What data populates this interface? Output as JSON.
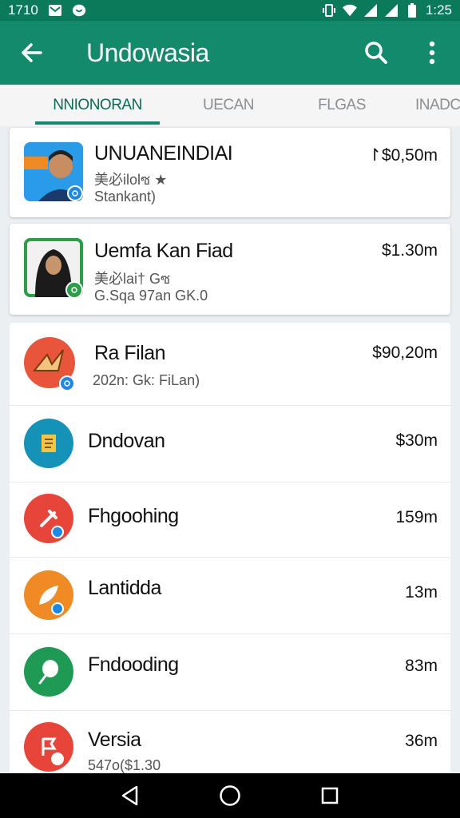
{
  "status_bar": {
    "time_left": "1710",
    "time_right": "1:25",
    "icons": [
      "mail-icon",
      "heart-icon",
      "vibrate-icon",
      "wifi-icon",
      "signal-icon",
      "signal-icon",
      "battery-icon"
    ]
  },
  "app_bar": {
    "title": "Undowasia",
    "back_icon": "arrow-left-icon",
    "search_icon": "search-icon",
    "menu_icon": "more-vert-icon"
  },
  "tabs": [
    {
      "label": "NNIONORAN",
      "active": true
    },
    {
      "label": "UECAN",
      "active": false
    },
    {
      "label": "FLGAS",
      "active": false
    },
    {
      "label": "INADC",
      "active": false
    }
  ],
  "items": [
    {
      "title": "UNUANEINDIAI",
      "sub1": "美必ilolซ ★",
      "sub2": "Stankant)",
      "amount": "↾$0,50m",
      "icon": "person-photo",
      "color": "#1e88e5"
    },
    {
      "title": "Uemfa Kan Fiad",
      "sub1": "美必lai† Gซ",
      "sub2": "G.Sqa 97an GK.0",
      "amount": "$1.30m",
      "icon": "person-photo",
      "color": "#2e9d4a"
    },
    {
      "title": "Ra Filan",
      "sub1": "202n: Gk: FiLan)",
      "amount": "$90,20m",
      "icon": "bird-icon",
      "color": "#e8553a"
    },
    {
      "title": "Dndovan",
      "amount": "$30m",
      "icon": "document-icon",
      "color": "#1592b8"
    },
    {
      "title": "Fhgoohing",
      "amount": "159m",
      "icon": "tool-icon",
      "color": "#e8453a"
    },
    {
      "title": "Lantidda",
      "amount": "13m",
      "icon": "leaf-icon",
      "color": "#f08a24"
    },
    {
      "title": "Fndooding",
      "amount": "83m",
      "icon": "balloon-icon",
      "color": "#1e9a55"
    },
    {
      "title": "Versia",
      "sub1": "547o($1.30",
      "amount": "36m",
      "icon": "flag-icon",
      "color": "#e8453a"
    }
  ],
  "nav": [
    "back-triangle-icon",
    "home-circle-icon",
    "recents-square-icon"
  ]
}
